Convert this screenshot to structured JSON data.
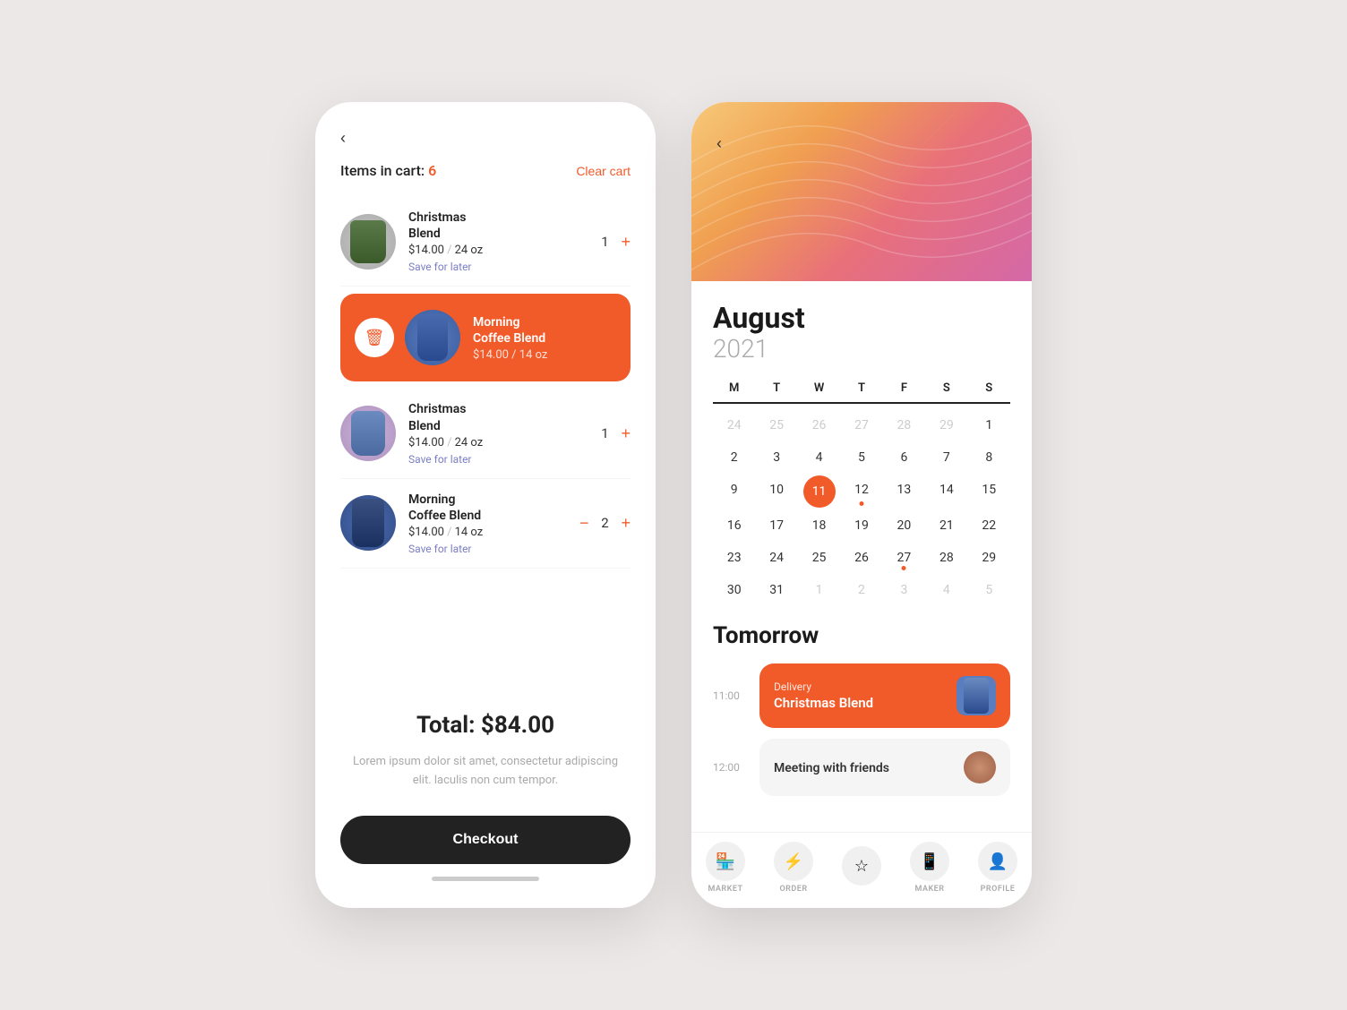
{
  "cart": {
    "back_label": "‹",
    "title_prefix": "Items in cart: ",
    "item_count": "6",
    "clear_btn": "Clear cart",
    "items": [
      {
        "id": "christmas1",
        "name": "Christmas Blend",
        "price": "$14.00",
        "size": "24 oz",
        "qty": "1",
        "save_later": "Save for later",
        "img_class": "item-img-christmas1",
        "icon": "☕"
      },
      {
        "id": "morning1",
        "name": "Morning Coffee Blend",
        "price": "$14.00",
        "size": "14 oz",
        "qty": null,
        "save_later": null,
        "img_class": "item-img-morning1",
        "icon": "☕",
        "swipe_delete": true
      },
      {
        "id": "christmas2",
        "name": "Christmas Blend",
        "price": "$14.00",
        "size": "24 oz",
        "qty": "1",
        "save_later": "Save for later",
        "img_class": "item-img-christmas2",
        "icon": "☕"
      },
      {
        "id": "morning2",
        "name": "Morning Coffee Blend",
        "price": "$14.00",
        "size": "14 oz",
        "qty": "2",
        "save_later": "Save for later",
        "img_class": "item-img-morning2",
        "icon": "☕"
      }
    ],
    "total_label": "Total: $84.00",
    "description": "Lorem ipsum dolor sit amet, consectetur adipiscing elit. laculis non cum tempor.",
    "checkout_btn": "Checkout"
  },
  "calendar": {
    "back_label": "‹",
    "month": "August",
    "year": "2021",
    "day_headers": [
      "M",
      "T",
      "W",
      "T",
      "F",
      "S",
      "S"
    ],
    "weeks": [
      [
        {
          "day": "24",
          "other": true
        },
        {
          "day": "25",
          "other": true
        },
        {
          "day": "26",
          "other": true
        },
        {
          "day": "27",
          "other": true
        },
        {
          "day": "28",
          "other": true
        },
        {
          "day": "29",
          "other": true
        },
        {
          "day": "1"
        }
      ],
      [
        {
          "day": "2"
        },
        {
          "day": "3"
        },
        {
          "day": "4"
        },
        {
          "day": "5"
        },
        {
          "day": "6"
        },
        {
          "day": "7"
        },
        {
          "day": "8"
        }
      ],
      [
        {
          "day": "9"
        },
        {
          "day": "10"
        },
        {
          "day": "11",
          "today": true
        },
        {
          "day": "12",
          "dot": true
        },
        {
          "day": "13"
        },
        {
          "day": "14"
        },
        {
          "day": "15"
        }
      ],
      [
        {
          "day": "16"
        },
        {
          "day": "17"
        },
        {
          "day": "18"
        },
        {
          "day": "19"
        },
        {
          "day": "20"
        },
        {
          "day": "21"
        },
        {
          "day": "22"
        }
      ],
      [
        {
          "day": "23"
        },
        {
          "day": "24"
        },
        {
          "day": "25"
        },
        {
          "day": "26"
        },
        {
          "day": "27",
          "dot": true
        },
        {
          "day": "28"
        },
        {
          "day": "29"
        }
      ],
      [
        {
          "day": "30"
        },
        {
          "day": "31"
        },
        {
          "day": "1",
          "other": true
        },
        {
          "day": "2",
          "other": true
        },
        {
          "day": "3",
          "other": true
        },
        {
          "day": "4",
          "other": true
        },
        {
          "day": "5",
          "other": true
        }
      ]
    ],
    "tomorrow_title": "Tomorrow",
    "events": [
      {
        "time": "11:00",
        "type": "delivery",
        "label": "Delivery",
        "name": "Christmas Blend",
        "has_img": true
      },
      {
        "time": "12:00",
        "type": "meeting",
        "label": "",
        "name": "Meeting with friends",
        "has_avatar": true
      }
    ],
    "nav_items": [
      {
        "id": "market",
        "label": "MARKET",
        "icon": "🏪"
      },
      {
        "id": "order",
        "label": "ORDER",
        "icon": "⚡"
      },
      {
        "id": "favorites",
        "label": "",
        "icon": "☆"
      },
      {
        "id": "maker",
        "label": "MAKER",
        "icon": "📱"
      },
      {
        "id": "profile",
        "label": "PROFILE",
        "icon": "👤"
      }
    ]
  }
}
